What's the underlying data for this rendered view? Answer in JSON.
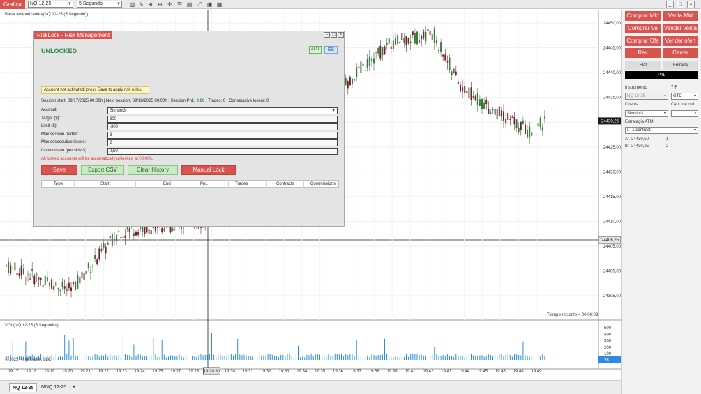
{
  "toolbar": {
    "title": "Grafica",
    "instrument": "NQ 12-25",
    "interval": "5 Segundo",
    "icons": [
      "bar-chart-icon",
      "pencil-icon",
      "zoom-in-icon",
      "zoom-out-icon",
      "crosshair-icon",
      "properties-icon",
      "templates-icon",
      "chart-style-icon",
      "fit-icon",
      "screenshot-icon",
      "data-box-icon"
    ],
    "win": [
      "_",
      "□",
      "×"
    ]
  },
  "chart": {
    "panel_title": "Barra temporizadora(NQ 12-25 (5 Segundo))",
    "price_ticks": [
      "24450,00",
      "24445,00",
      "24440,00",
      "24435,00",
      "24430,00",
      "24425,00",
      "24420,00",
      "24415,00",
      "24410,00",
      "24405,00",
      "24400,00",
      "24395,00"
    ],
    "last_price": "24430,25",
    "cursor_price": "24406,25",
    "time_remaining": "Tiempo restante = 00:00:03",
    "volume_title": "VOL(NQ 12-25 (5 Segundo))",
    "volume_ticks": [
      "500",
      "400",
      "300",
      "200",
      "100"
    ],
    "volume_last": "26",
    "copyright": "© 2025 NinjaTrader, LLC",
    "time_ticks": [
      "19:17",
      "19:18",
      "19:19",
      "19:20",
      "19:21",
      "19:22",
      "19:23",
      "19:24",
      "19:25",
      "19:27",
      "19:28",
      "19:29:30",
      "19:30",
      "19:31",
      "19:32",
      "19:33",
      "19:34",
      "19:35",
      "19:36",
      "19:37",
      "19:38",
      "19:39",
      "19:41",
      "19:42",
      "19:43",
      "19:44",
      "19:45",
      "19:46",
      "19:48",
      "19:49"
    ],
    "colors": {
      "up": "#3a7a3a",
      "down": "#7a1e2a",
      "volume": "#2b8de0",
      "last_price_bg": "#1a1a1a",
      "volume_last_bg": "#2b8de0"
    }
  },
  "tabs": {
    "active": "NQ 12-25",
    "second": "MNQ 12-25",
    "add": "+"
  },
  "order_panel": {
    "buttons": {
      "buy_mkt": "Comprar Mkt",
      "sell_mkt": "Venta Mkt",
      "buy_ask": "Comprar Ve",
      "sell_ask": "Vender venta",
      "buy_bid": "Comprar Ofe",
      "sell_bid": "Vender ofert",
      "rev": "Rev",
      "close": "Cerrar"
    },
    "position_state": "Flat",
    "entry_label": "Entrada",
    "pnl_label": "PnL",
    "instrument_label": "Instrumento",
    "instrument_value": "NQ 12-25",
    "tif_label": "TIF",
    "tif_value": "GTC",
    "account_label": "Cuenta",
    "account_value": "Simsim3",
    "qty_label": "Cant. de ord...",
    "qty_value": "1",
    "atm_label": "Estrategia ATM",
    "atm_value": "1 contract",
    "ask_label": "A:",
    "ask_price": "24430,50",
    "ask_size": "1",
    "bid_label": "B:",
    "bid_price": "24430,25",
    "bid_size": "2"
  },
  "risklock": {
    "title": "RiskLock - Risk Management",
    "status": "UNLOCKED",
    "badge_aot": "AOT",
    "badge_symbol": "ES",
    "warning": "Account not activated: press Save to apply risk rules.",
    "session_text": "Session start: 09/17/2025 00:00h | Next session: 09/18/2025 00:00h | Session PnL:",
    "session_pnl": "0.00",
    "session_tail": "| Trades: 0 | Consecutive losers: 0",
    "fields": [
      {
        "label": "Account:",
        "value": "Simsim3"
      },
      {
        "label": "Target ($):",
        "value": "300"
      },
      {
        "label": "Limit ($):",
        "value": "-300"
      },
      {
        "label": "Max session trades:",
        "value": "3"
      },
      {
        "label": "Max consecutive losers:",
        "value": "2"
      },
      {
        "label": "Commission (per side $):",
        "value": "0,50"
      }
    ],
    "note": "All locked accounts will be automatically unlocked at 00:00h.",
    "buttons": {
      "save": "Save",
      "export": "Export CSV",
      "clear": "Clear History",
      "lock": "Manual Lock"
    },
    "columns": [
      "Type",
      "Start",
      "End",
      "PnL",
      "Trades",
      "Contracts",
      "Commissions"
    ]
  }
}
